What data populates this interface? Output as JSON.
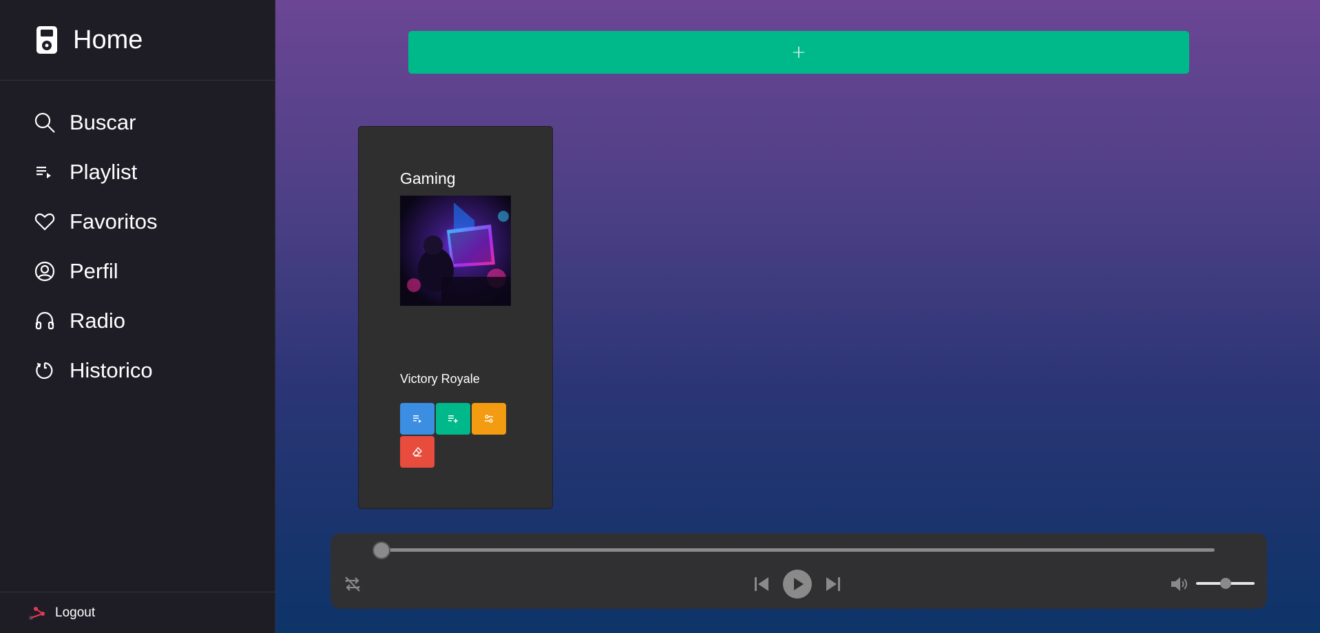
{
  "sidebar": {
    "home_label": "Home",
    "items": [
      {
        "label": "Buscar",
        "icon": "search-icon"
      },
      {
        "label": "Playlist",
        "icon": "playlist-icon"
      },
      {
        "label": "Favoritos",
        "icon": "heart-icon"
      },
      {
        "label": "Perfil",
        "icon": "user-circle-icon"
      },
      {
        "label": "Radio",
        "icon": "headphones-icon"
      },
      {
        "label": "Historico",
        "icon": "history-icon"
      }
    ],
    "logout_label": "Logout"
  },
  "main": {
    "add_button_label": "+",
    "card": {
      "title": "Gaming",
      "song": "Victory Royale",
      "actions": [
        {
          "icon": "playlist-play-icon",
          "color": "#3c8ee2"
        },
        {
          "icon": "playlist-add-icon",
          "color": "#00b98a"
        },
        {
          "icon": "settings-sliders-icon",
          "color": "#f39c12"
        },
        {
          "icon": "eraser-icon",
          "color": "#e74c3c"
        }
      ]
    }
  },
  "player": {
    "progress_fraction": 0.0,
    "volume_fraction": 0.5
  },
  "colors": {
    "accent": "#00b98a",
    "sidebar_bg": "#1e1d26",
    "card_bg": "#2f2f2f",
    "player_bg": "#303033"
  }
}
